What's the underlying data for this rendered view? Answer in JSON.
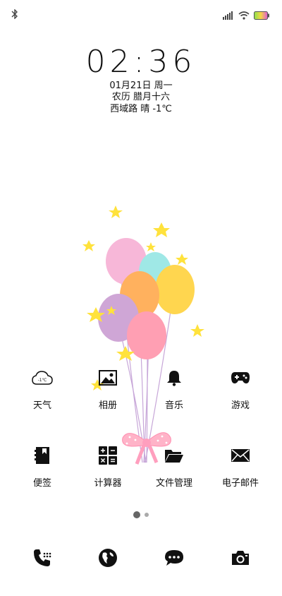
{
  "status_bar": {
    "left_icon": "bluetooth-icon",
    "right_icons": [
      "signal-icon",
      "wifi-icon",
      "battery-icon"
    ]
  },
  "lock": {
    "time": "02:36",
    "date": "01月21日 周一",
    "lunar": "农历 腊月十六",
    "weather": "西域路 晴 -1℃"
  },
  "apps": [
    {
      "label": "天气",
      "icon": "weather-icon",
      "icon_text": "-1℃"
    },
    {
      "label": "相册",
      "icon": "gallery-icon"
    },
    {
      "label": "音乐",
      "icon": "bell-icon"
    },
    {
      "label": "游戏",
      "icon": "gamepad-icon"
    },
    {
      "label": "便签",
      "icon": "notes-icon"
    },
    {
      "label": "计算器",
      "icon": "calculator-icon"
    },
    {
      "label": "文件管理",
      "icon": "folder-icon"
    },
    {
      "label": "电子邮件",
      "icon": "mail-icon"
    }
  ],
  "dock": [
    "phone-icon",
    "browser-icon",
    "messages-icon",
    "camera-icon"
  ],
  "page_indicator": {
    "current": 1,
    "total": 2
  },
  "colors": {
    "balloon_pink": "#f7b7d8",
    "balloon_cyan": "#9fe8e6",
    "balloon_yellow": "#ffd64f",
    "balloon_orange": "#ffb15e",
    "balloon_purple": "#cfa6d6",
    "balloon_rose": "#ff9fb3",
    "star": "#ffe23c"
  }
}
